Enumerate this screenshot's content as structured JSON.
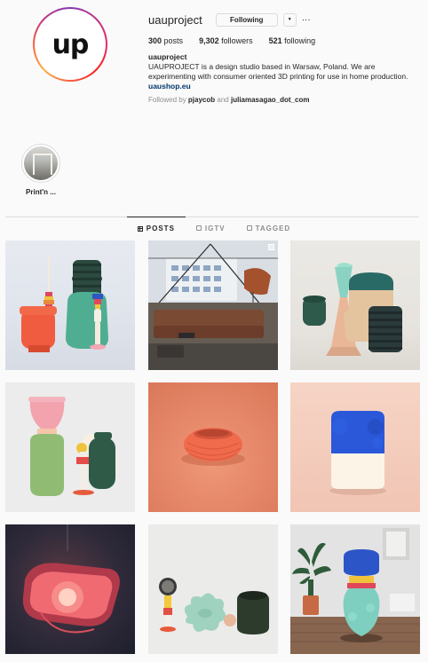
{
  "profile": {
    "username": "uauproject",
    "follow_button": "Following",
    "avatar_text": "up",
    "stats": {
      "posts_count": "300",
      "posts_label": "posts",
      "followers_count": "9,302",
      "followers_label": "followers",
      "following_count": "521",
      "following_label": "following"
    },
    "bio": {
      "name": "uauproject",
      "text": "UAUPROJECT is a design studio based in Warsaw, Poland. We are experimenting with consumer oriented 3D printing for use in home production.",
      "link": "uaushop.eu"
    },
    "followed_by": {
      "prefix": "Followed by",
      "user1": "pjaycob",
      "and": "and",
      "user2": "juliamasagao_dot_com"
    }
  },
  "highlights": [
    {
      "label": "Print'n ..."
    }
  ],
  "tabs": [
    {
      "label": "POSTS",
      "icon": "grid-icon",
      "active": true
    },
    {
      "label": "IGTV",
      "icon": "igtv-icon",
      "active": false
    },
    {
      "label": "TAGGED",
      "icon": "tag-icon",
      "active": false
    }
  ],
  "posts": [
    {
      "description": "vases-orange-green"
    },
    {
      "description": "living-room-sofa",
      "multi": true
    },
    {
      "description": "green-vases-beige"
    },
    {
      "description": "pink-green-vase"
    },
    {
      "description": "orange-knit-bowl"
    },
    {
      "description": "blue-white-vase"
    },
    {
      "description": "pink-lamp"
    },
    {
      "description": "flower-vases"
    },
    {
      "description": "blue-vase-room"
    }
  ],
  "colors": {
    "link": "#00376b",
    "muted": "#8e8e8e",
    "text": "#262626",
    "border": "#dbdbdb"
  }
}
